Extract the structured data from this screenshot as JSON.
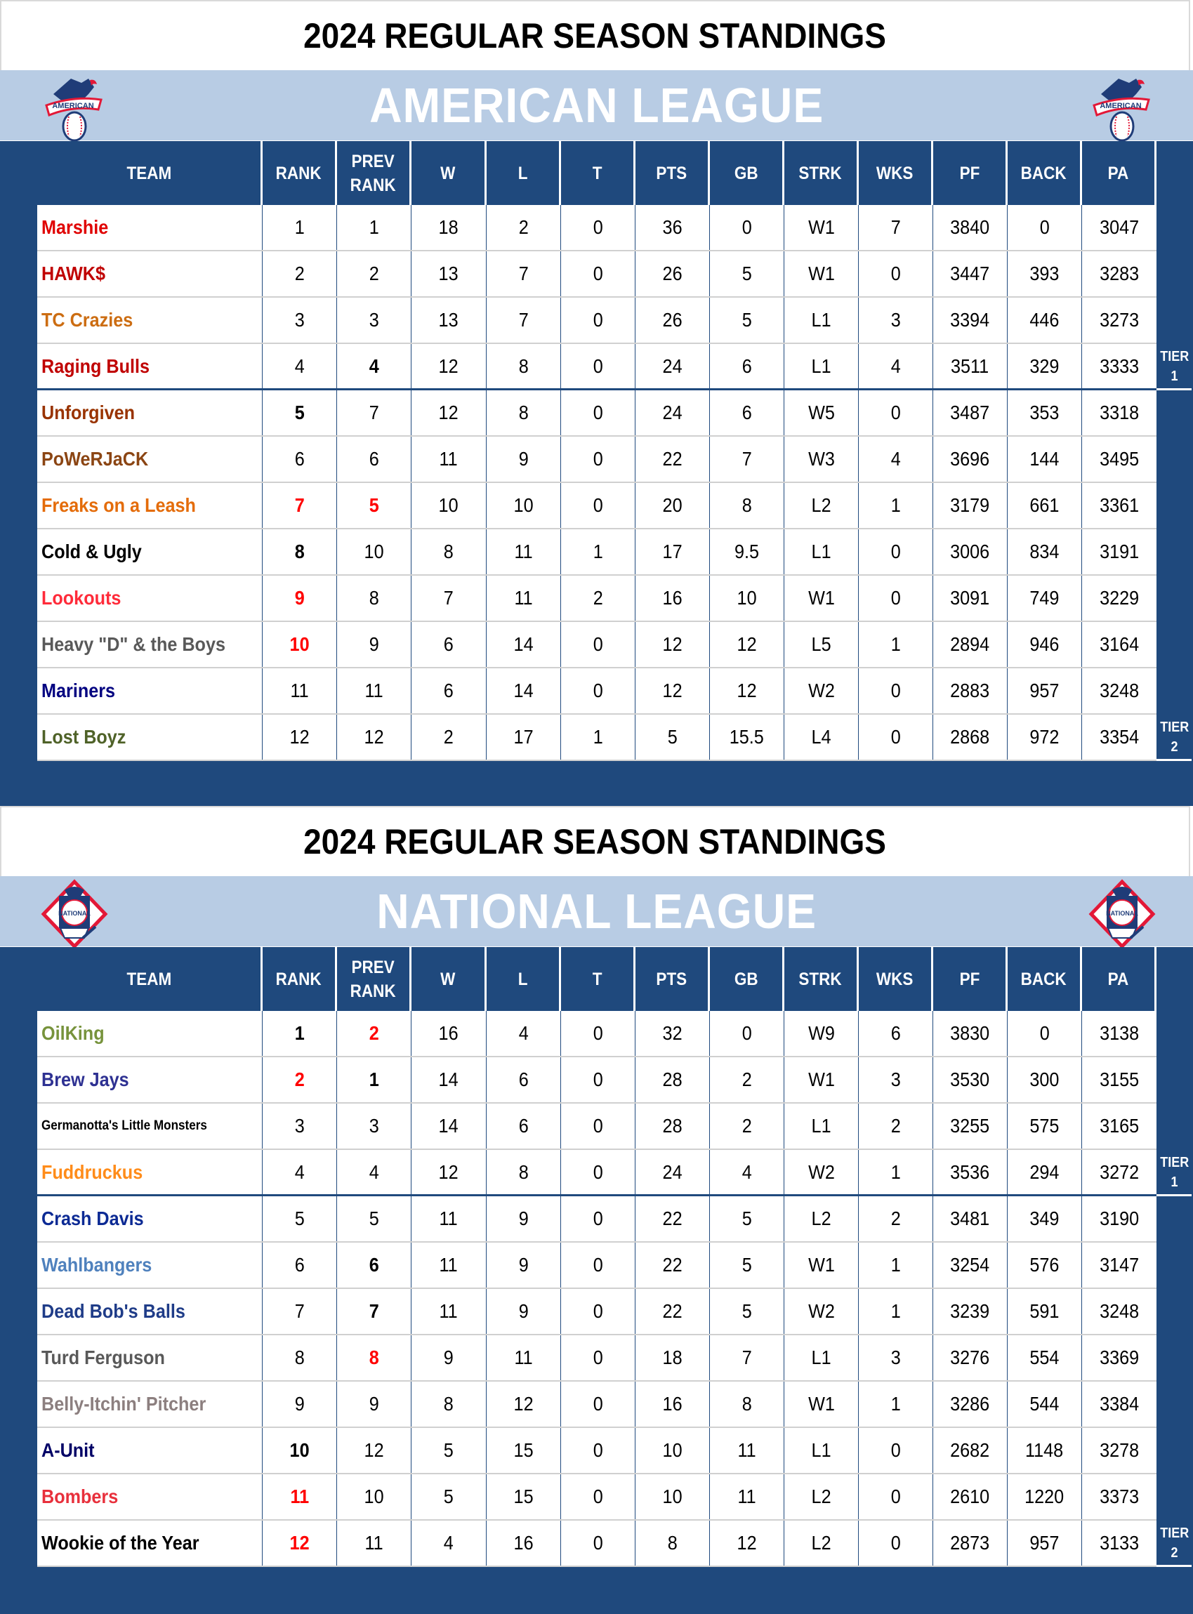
{
  "colors": {
    "navy": "#1f497d",
    "light_blue": "#b8cce4",
    "highlight_red": "#ff0000"
  },
  "columns": [
    "TEAM",
    "RANK",
    "PREV\nRANK",
    "W",
    "L",
    "T",
    "PTS",
    "GB",
    "STRK",
    "WKS",
    "PF",
    "BACK",
    "PA"
  ],
  "leagues": [
    {
      "title": "2024 REGULAR SEASON STANDINGS",
      "name": "AMERICAN LEAGUE",
      "logo": "american-league-logo",
      "tiers": [
        {
          "label": "TIER",
          "num": "1"
        },
        {
          "label": "TIER",
          "num": "2"
        }
      ],
      "teams": [
        {
          "team": "Marshie",
          "color": "#e00000",
          "rank": "1",
          "prev": "1",
          "w": "18",
          "l": "2",
          "t": "0",
          "pts": "36",
          "gb": "0",
          "strk": "W1",
          "wks": "7",
          "pf": "3840",
          "back": "0",
          "pa": "3047",
          "rank_style": "",
          "prev_style": ""
        },
        {
          "team": "HAWK$",
          "color": "#c00000",
          "rank": "2",
          "prev": "2",
          "w": "13",
          "l": "7",
          "t": "0",
          "pts": "26",
          "gb": "5",
          "strk": "W1",
          "wks": "0",
          "pf": "3447",
          "back": "393",
          "pa": "3283",
          "rank_style": "",
          "prev_style": ""
        },
        {
          "team": "TC Crazies",
          "color": "#cc6d12",
          "rank": "3",
          "prev": "3",
          "w": "13",
          "l": "7",
          "t": "0",
          "pts": "26",
          "gb": "5",
          "strk": "L1",
          "wks": "3",
          "pf": "3394",
          "back": "446",
          "pa": "3273",
          "rank_style": "",
          "prev_style": ""
        },
        {
          "team": "Raging Bulls",
          "color": "#c00000",
          "rank": "4",
          "prev": "4",
          "w": "12",
          "l": "8",
          "t": "0",
          "pts": "24",
          "gb": "6",
          "strk": "L1",
          "wks": "4",
          "pf": "3511",
          "back": "329",
          "pa": "3333",
          "rank_style": "",
          "prev_style": "bold"
        },
        {
          "team": "Unforgiven",
          "color": "#993300",
          "rank": "5",
          "prev": "7",
          "w": "12",
          "l": "8",
          "t": "0",
          "pts": "24",
          "gb": "6",
          "strk": "W5",
          "wks": "0",
          "pf": "3487",
          "back": "353",
          "pa": "3318",
          "rank_style": "bold",
          "prev_style": ""
        },
        {
          "team": "PoWeRJaCK",
          "color": "#8b4513",
          "rank": "6",
          "prev": "6",
          "w": "11",
          "l": "9",
          "t": "0",
          "pts": "22",
          "gb": "7",
          "strk": "W3",
          "wks": "4",
          "pf": "3696",
          "back": "144",
          "pa": "3495",
          "rank_style": "",
          "prev_style": ""
        },
        {
          "team": "Freaks on a Leash",
          "color": "#e46c0a",
          "rank": "7",
          "prev": "5",
          "w": "10",
          "l": "10",
          "t": "0",
          "pts": "20",
          "gb": "8",
          "strk": "L2",
          "wks": "1",
          "pf": "3179",
          "back": "661",
          "pa": "3361",
          "rank_style": "red",
          "prev_style": "red"
        },
        {
          "team": "Cold & Ugly",
          "color": "#000000",
          "rank": "8",
          "prev": "10",
          "w": "8",
          "l": "11",
          "t": "1",
          "pts": "17",
          "gb": "9.5",
          "strk": "L1",
          "wks": "0",
          "pf": "3006",
          "back": "834",
          "pa": "3191",
          "rank_style": "bold",
          "prev_style": ""
        },
        {
          "team": "Lookouts",
          "color": "#ff2b3a",
          "rank": "9",
          "prev": "8",
          "w": "7",
          "l": "11",
          "t": "2",
          "pts": "16",
          "gb": "10",
          "strk": "W1",
          "wks": "0",
          "pf": "3091",
          "back": "749",
          "pa": "3229",
          "rank_style": "red",
          "prev_style": ""
        },
        {
          "team": "Heavy \"D\" & the Boys",
          "color": "#595959",
          "rank": "10",
          "prev": "9",
          "w": "6",
          "l": "14",
          "t": "0",
          "pts": "12",
          "gb": "12",
          "strk": "L5",
          "wks": "1",
          "pf": "2894",
          "back": "946",
          "pa": "3164",
          "rank_style": "red",
          "prev_style": ""
        },
        {
          "team": "Mariners",
          "color": "#000080",
          "rank": "11",
          "prev": "11",
          "w": "6",
          "l": "14",
          "t": "0",
          "pts": "12",
          "gb": "12",
          "strk": "W2",
          "wks": "0",
          "pf": "2883",
          "back": "957",
          "pa": "3248",
          "rank_style": "",
          "prev_style": ""
        },
        {
          "team": "Lost Boyz",
          "color": "#4f6228",
          "rank": "12",
          "prev": "12",
          "w": "2",
          "l": "17",
          "t": "1",
          "pts": "5",
          "gb": "15.5",
          "strk": "L4",
          "wks": "0",
          "pf": "2868",
          "back": "972",
          "pa": "3354",
          "rank_style": "",
          "prev_style": ""
        }
      ]
    },
    {
      "title": "2024 REGULAR SEASON STANDINGS",
      "name": "NATIONAL LEAGUE",
      "logo": "national-league-logo",
      "tiers": [
        {
          "label": "TIER",
          "num": "1"
        },
        {
          "label": "TIER",
          "num": "2"
        }
      ],
      "teams": [
        {
          "team": "OilKing",
          "color": "#77933c",
          "rank": "1",
          "prev": "2",
          "w": "16",
          "l": "4",
          "t": "0",
          "pts": "32",
          "gb": "0",
          "strk": "W9",
          "wks": "6",
          "pf": "3830",
          "back": "0",
          "pa": "3138",
          "rank_style": "bold",
          "prev_style": "red"
        },
        {
          "team": "Brew Jays",
          "color": "#2e3192",
          "rank": "2",
          "prev": "1",
          "w": "14",
          "l": "6",
          "t": "0",
          "pts": "28",
          "gb": "2",
          "strk": "W1",
          "wks": "3",
          "pf": "3530",
          "back": "300",
          "pa": "3155",
          "rank_style": "red",
          "prev_style": "bold"
        },
        {
          "team": "Germanotta's Little Monsters",
          "color": "#000000",
          "rank": "3",
          "prev": "3",
          "w": "14",
          "l": "6",
          "t": "0",
          "pts": "28",
          "gb": "2",
          "strk": "L1",
          "wks": "2",
          "pf": "3255",
          "back": "575",
          "pa": "3165",
          "rank_style": "",
          "prev_style": "",
          "small": true
        },
        {
          "team": "Fuddruckus",
          "color": "#ff8c1a",
          "rank": "4",
          "prev": "4",
          "w": "12",
          "l": "8",
          "t": "0",
          "pts": "24",
          "gb": "4",
          "strk": "W2",
          "wks": "1",
          "pf": "3536",
          "back": "294",
          "pa": "3272",
          "rank_style": "",
          "prev_style": ""
        },
        {
          "team": "Crash Davis",
          "color": "#0c2a94",
          "rank": "5",
          "prev": "5",
          "w": "11",
          "l": "9",
          "t": "0",
          "pts": "22",
          "gb": "5",
          "strk": "L2",
          "wks": "2",
          "pf": "3481",
          "back": "349",
          "pa": "3190",
          "rank_style": "",
          "prev_style": ""
        },
        {
          "team": "Wahlbangers",
          "color": "#4f81bd",
          "rank": "6",
          "prev": "6",
          "w": "11",
          "l": "9",
          "t": "0",
          "pts": "22",
          "gb": "5",
          "strk": "W1",
          "wks": "1",
          "pf": "3254",
          "back": "576",
          "pa": "3147",
          "rank_style": "",
          "prev_style": "bold"
        },
        {
          "team": "Dead Bob's Balls",
          "color": "#1f3c88",
          "rank": "7",
          "prev": "7",
          "w": "11",
          "l": "9",
          "t": "0",
          "pts": "22",
          "gb": "5",
          "strk": "W2",
          "wks": "1",
          "pf": "3239",
          "back": "591",
          "pa": "3248",
          "rank_style": "",
          "prev_style": "bold"
        },
        {
          "team": "Turd Ferguson",
          "color": "#595959",
          "rank": "8",
          "prev": "8",
          "w": "9",
          "l": "11",
          "t": "0",
          "pts": "18",
          "gb": "7",
          "strk": "L1",
          "wks": "3",
          "pf": "3276",
          "back": "554",
          "pa": "3369",
          "rank_style": "",
          "prev_style": "red"
        },
        {
          "team": "Belly-Itchin' Pitcher",
          "color": "#8c7f7f",
          "rank": "9",
          "prev": "9",
          "w": "8",
          "l": "12",
          "t": "0",
          "pts": "16",
          "gb": "8",
          "strk": "W1",
          "wks": "1",
          "pf": "3286",
          "back": "544",
          "pa": "3384",
          "rank_style": "",
          "prev_style": ""
        },
        {
          "team": "A-Unit",
          "color": "#000066",
          "rank": "10",
          "prev": "12",
          "w": "5",
          "l": "15",
          "t": "0",
          "pts": "10",
          "gb": "11",
          "strk": "L1",
          "wks": "0",
          "pf": "2682",
          "back": "1148",
          "pa": "3278",
          "rank_style": "bold",
          "prev_style": ""
        },
        {
          "team": "Bombers",
          "color": "#e8303c",
          "rank": "11",
          "prev": "10",
          "w": "5",
          "l": "15",
          "t": "0",
          "pts": "10",
          "gb": "11",
          "strk": "L2",
          "wks": "0",
          "pf": "2610",
          "back": "1220",
          "pa": "3373",
          "rank_style": "red",
          "prev_style": ""
        },
        {
          "team": "Wookie of the Year",
          "color": "#000000",
          "rank": "12",
          "prev": "11",
          "w": "4",
          "l": "16",
          "t": "0",
          "pts": "8",
          "gb": "12",
          "strk": "L2",
          "wks": "0",
          "pf": "2873",
          "back": "957",
          "pa": "3133",
          "rank_style": "red",
          "prev_style": ""
        }
      ]
    }
  ]
}
